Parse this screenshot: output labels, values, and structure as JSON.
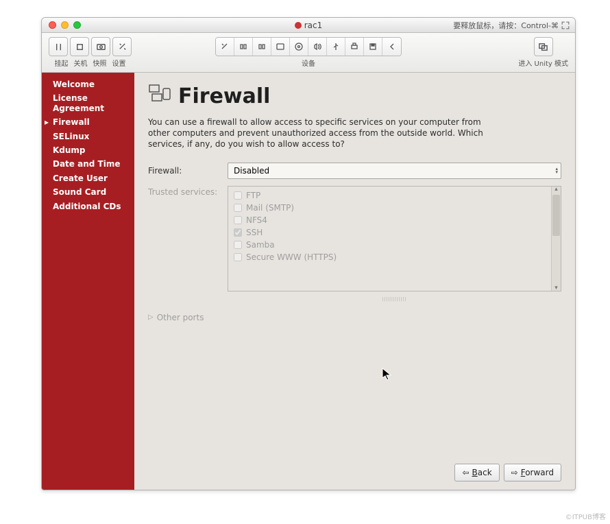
{
  "window": {
    "title": "rac1",
    "release_hint": "要释放鼠标，请按：Control-⌘"
  },
  "toolbar": {
    "left": {
      "suspend": "挂起",
      "shutdown": "关机",
      "snapshot": "快照",
      "settings": "设置"
    },
    "devices_label": "设备",
    "unity_label": "进入 Unity 模式"
  },
  "sidebar": {
    "items": [
      {
        "label": "Welcome"
      },
      {
        "label": "License Agreement"
      },
      {
        "label": "Firewall"
      },
      {
        "label": "SELinux"
      },
      {
        "label": "Kdump"
      },
      {
        "label": "Date and Time"
      },
      {
        "label": "Create User"
      },
      {
        "label": "Sound Card"
      },
      {
        "label": "Additional CDs"
      }
    ],
    "active_index": 2
  },
  "main": {
    "title": "Firewall",
    "description": "You can use a firewall to allow access to specific services on your computer from other computers and prevent unauthorized access from the outside world.  Which services, if any, do you wish to allow access to?",
    "firewall_label": "Firewall:",
    "firewall_value": "Disabled",
    "trusted_label": "Trusted services:",
    "services": [
      {
        "label": "FTP",
        "checked": false
      },
      {
        "label": "Mail (SMTP)",
        "checked": false
      },
      {
        "label": "NFS4",
        "checked": false
      },
      {
        "label": "SSH",
        "checked": true
      },
      {
        "label": "Samba",
        "checked": false
      },
      {
        "label": "Secure WWW (HTTPS)",
        "checked": false
      }
    ],
    "other_ports": "Other ports"
  },
  "footer": {
    "back": "Back",
    "forward": "Forward"
  },
  "watermark": "©ITPUB博客"
}
